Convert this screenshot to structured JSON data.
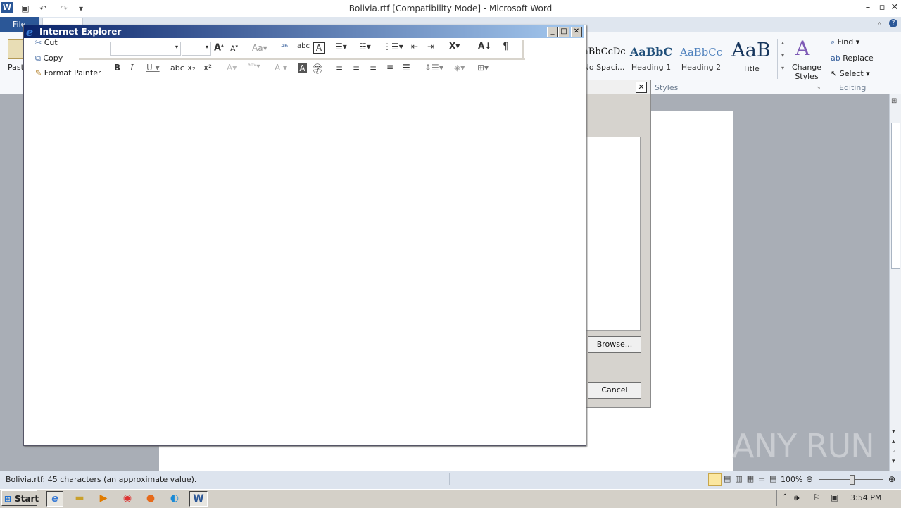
{
  "word": {
    "title": "Bolivia.rtf [Compatibility Mode]  -  Microsoft Word",
    "file_tab": "File",
    "paste_label": "Past",
    "styles": [
      {
        "preview": "aBbCcDc",
        "name": "No Spaci..."
      },
      {
        "preview": "AaBbC",
        "name": "Heading 1"
      },
      {
        "preview": "AaBbCc",
        "name": "Heading 2"
      },
      {
        "preview": "AaB",
        "name": "Title"
      }
    ],
    "change_styles": "Change Styles",
    "styles_group": "Styles",
    "editing_group": "Editing",
    "find": "Find",
    "replace": "Replace",
    "select": "Select",
    "status_text": "Bolivia.rtf: 45 characters (an approximate value).",
    "zoom": "100%"
  },
  "dialog": {
    "browse": "Browse...",
    "cancel": "Cancel"
  },
  "ie": {
    "title": "Internet Explorer",
    "clipboard": {
      "cut": "Cut",
      "copy": "Copy",
      "format_painter": "Format Painter"
    },
    "pilcrow": "¶"
  },
  "watermark": "ANY RUN",
  "taskbar": {
    "start": "Start",
    "clock": "3:54 PM"
  }
}
